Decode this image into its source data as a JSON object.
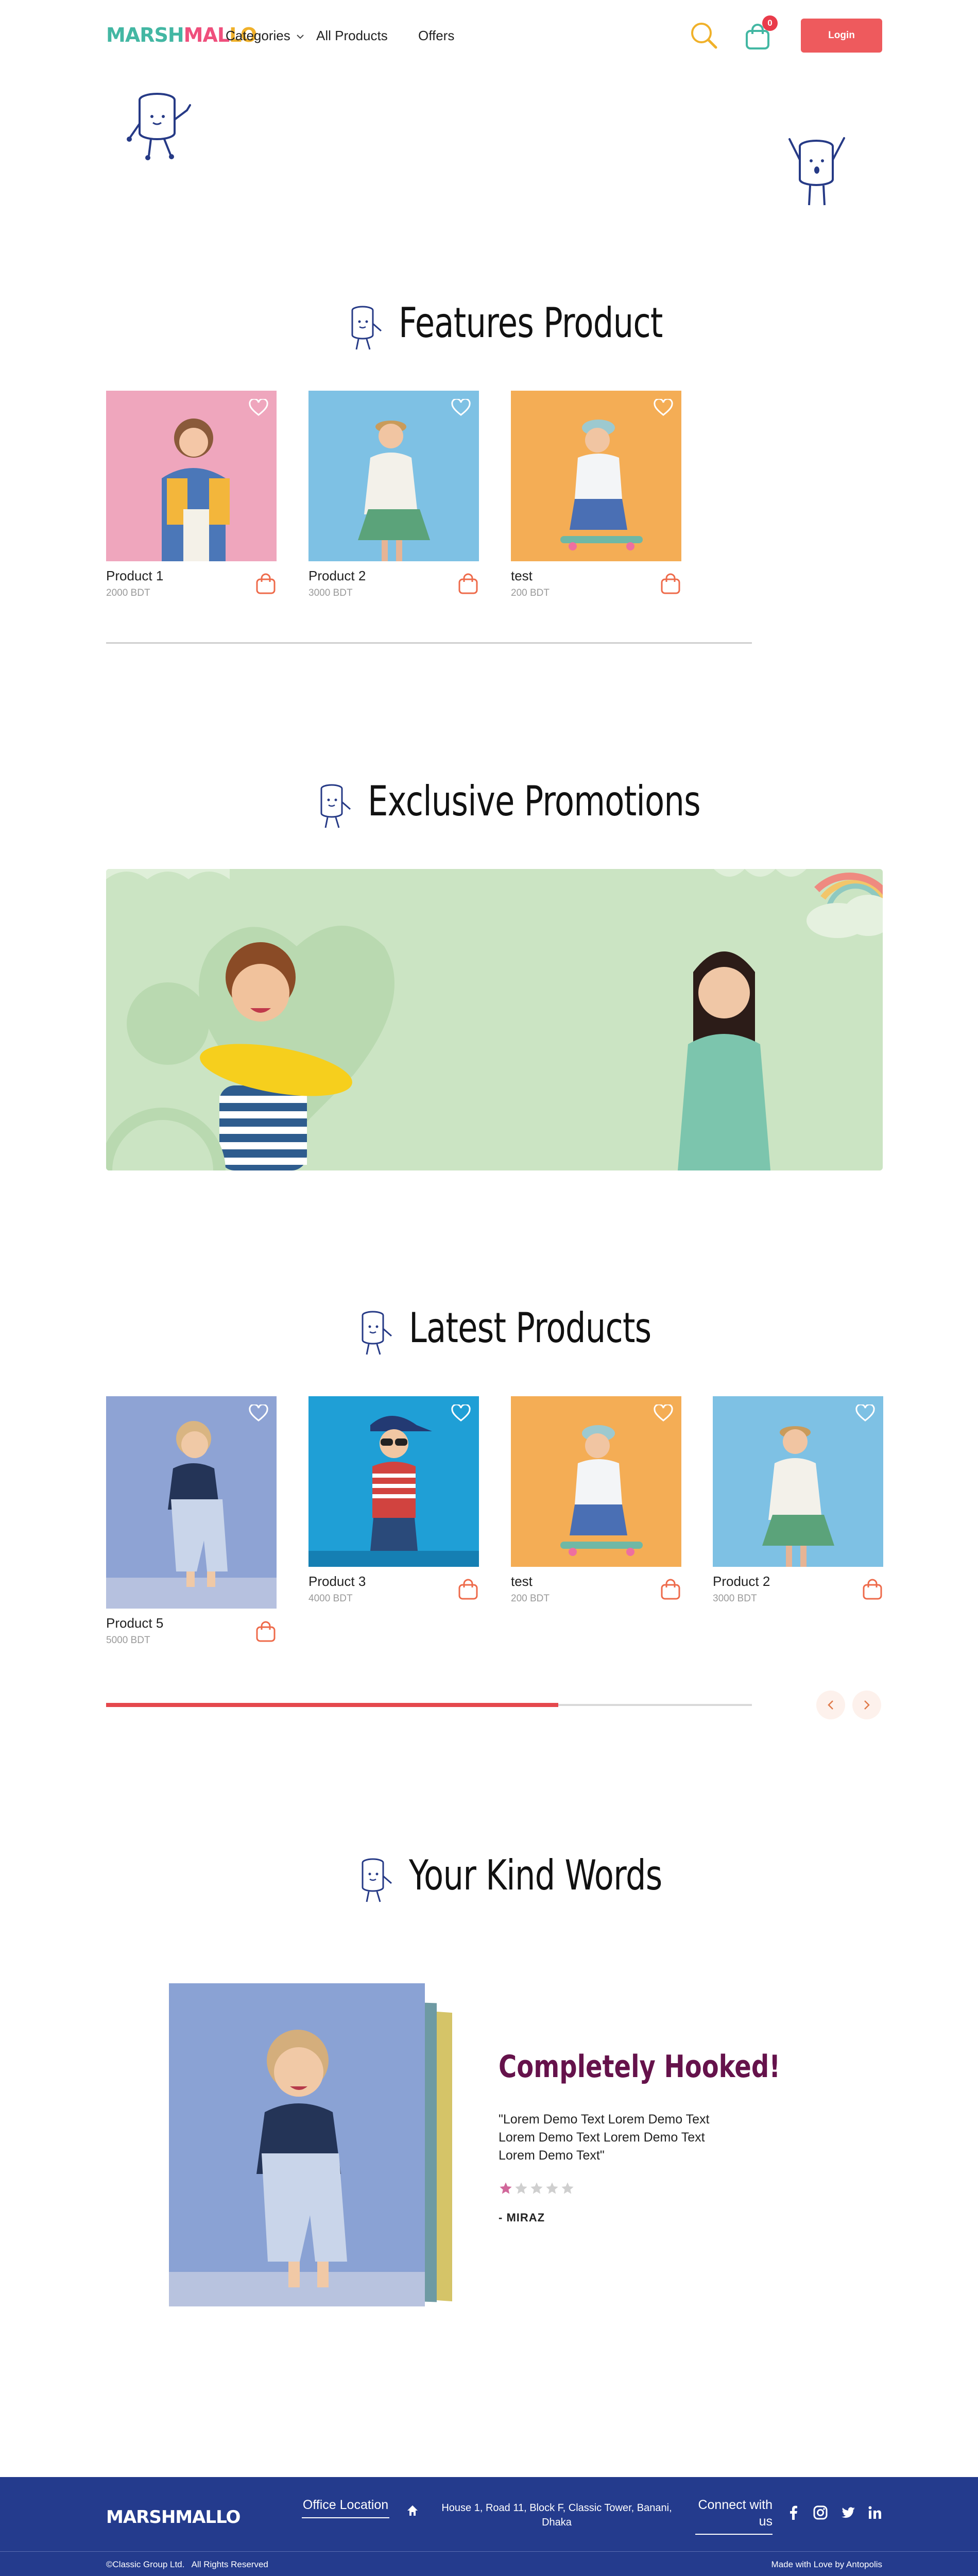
{
  "header": {
    "logo_part1": "MARSH",
    "logo_part2": "MAL",
    "logo_part3": "LO",
    "nav": {
      "categories": "Categories",
      "all_products": "All Products",
      "offers": "Offers"
    },
    "cart_count": "0",
    "login": "Login"
  },
  "featured": {
    "title": "Features Product",
    "products": [
      {
        "name": "Product 1",
        "price": "2000 BDT"
      },
      {
        "name": "Product 2",
        "price": "3000 BDT"
      },
      {
        "name": "test",
        "price": "200 BDT"
      }
    ]
  },
  "promotions": {
    "title": "Exclusive Promotions"
  },
  "latest": {
    "title": "Latest Products",
    "products": [
      {
        "name": "Product 5",
        "price": "5000 BDT"
      },
      {
        "name": "Product 3",
        "price": "4000 BDT"
      },
      {
        "name": "test",
        "price": "200 BDT"
      },
      {
        "name": "Product 2",
        "price": "3000 BDT"
      }
    ],
    "scroll_progress": 0.7
  },
  "testimonial": {
    "title": "Your Kind Words",
    "headline": "Completely Hooked!",
    "quote": "\"Lorem Demo Text Lorem Demo Text Lorem Demo Text Lorem Demo Text Lorem Demo Text\"",
    "rating": 1,
    "rating_max": 5,
    "reviewer": "- MIRAZ"
  },
  "footer": {
    "office_label": "Office Location",
    "address": "House 1, Road 11, Block F, Classic Tower, Banani, Dhaka",
    "connect_label": "Connect with us",
    "copyright": "©Classic Group Ltd.   All Rights Reserved",
    "credit": "Made with Love by Antopolis"
  },
  "colors": {
    "accent": "#ee5a5d",
    "footer_bg": "#243b8d",
    "headline": "#65124b",
    "logo_teal": "#43b7a3",
    "logo_pink": "#ef4f7c",
    "logo_yellow": "#f0b12a"
  },
  "icons": [
    "search-icon",
    "shopping-bag-icon",
    "heart-icon",
    "home-icon",
    "facebook-icon",
    "instagram-icon",
    "twitter-icon",
    "linkedin-icon",
    "chevron-left-icon",
    "chevron-right-icon",
    "star-icon",
    "marshmallow-mascot-icon"
  ]
}
